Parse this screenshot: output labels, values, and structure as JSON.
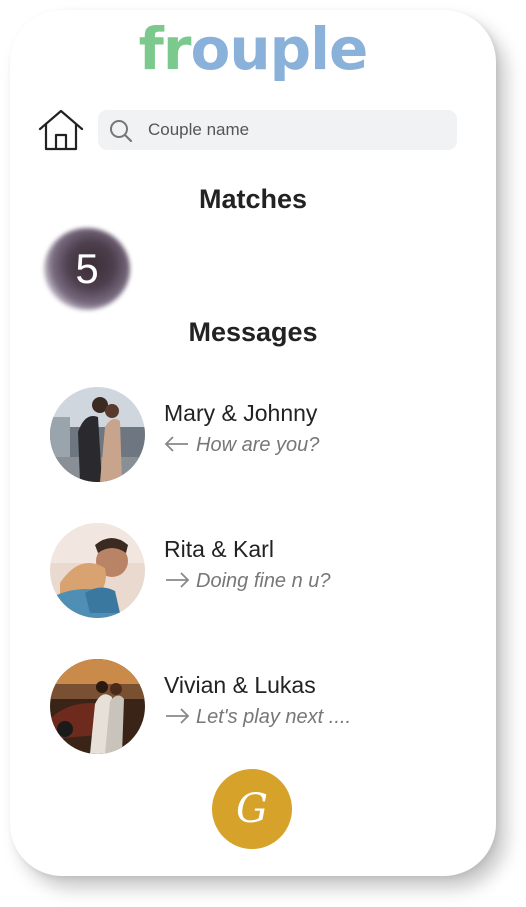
{
  "app": {
    "logo_part_a": "fr",
    "logo_part_b": "ouple",
    "logo_color_a": "#7cc98d",
    "logo_color_b": "#8ab1d9"
  },
  "header": {
    "home_icon": "home-icon",
    "search": {
      "icon": "search-icon",
      "placeholder": "Couple name",
      "value": ""
    }
  },
  "matches": {
    "title": "Matches",
    "count": "5"
  },
  "messages": {
    "title": "Messages",
    "items": [
      {
        "name": "Mary & Johnny",
        "direction": "incoming",
        "arrow_icon": "arrow-left-icon",
        "text": "How are you?"
      },
      {
        "name": "Rita & Karl",
        "direction": "outgoing",
        "arrow_icon": "arrow-right-icon",
        "text": "Doing fine n u?"
      },
      {
        "name": "Vivian & Lukas",
        "direction": "outgoing",
        "arrow_icon": "arrow-right-icon",
        "text": "Let's play next ...."
      }
    ]
  },
  "fab": {
    "label": "G",
    "color": "#d6a22a"
  }
}
